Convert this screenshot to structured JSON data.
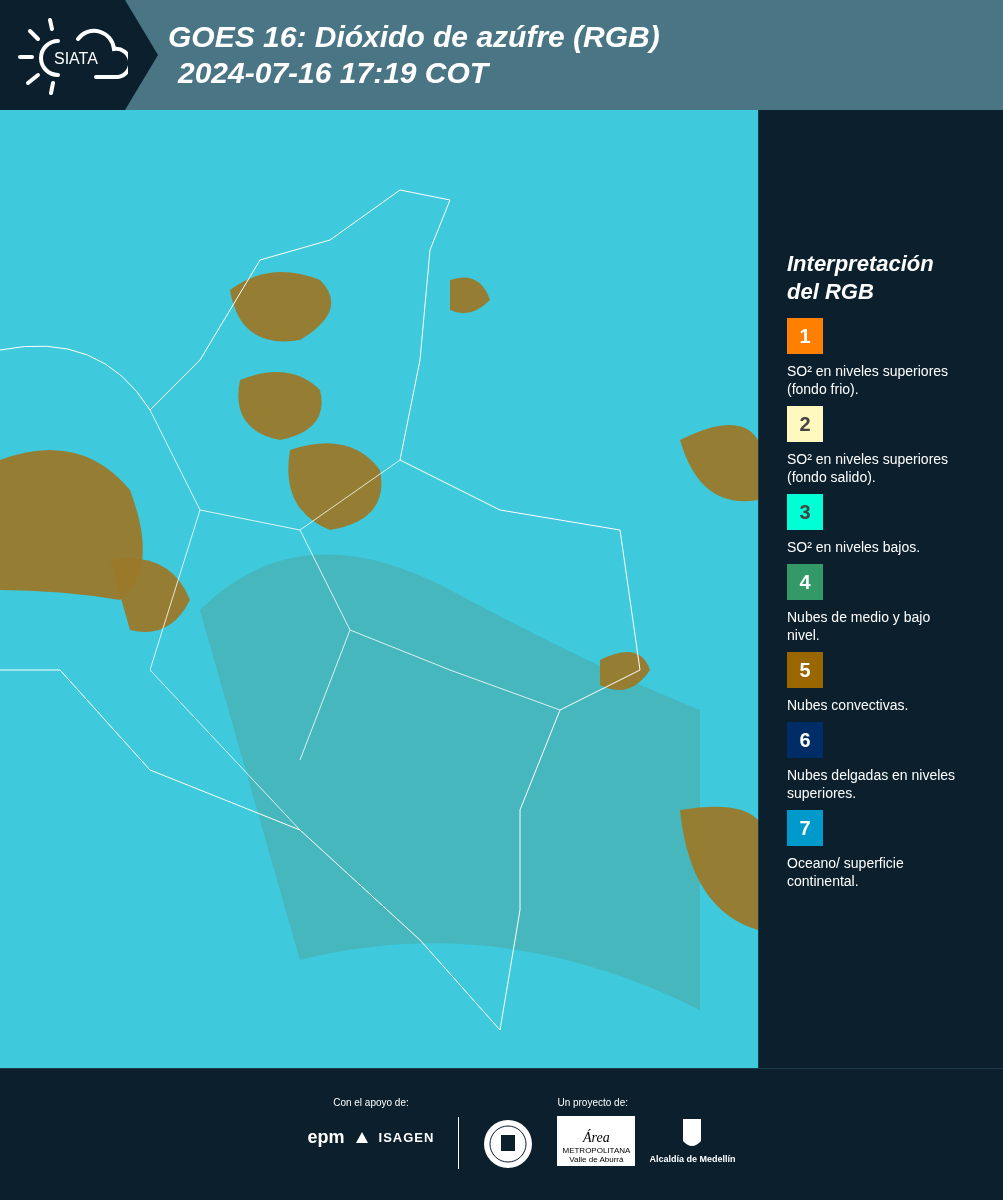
{
  "header": {
    "logo": "SIATA",
    "title": "GOES 16: Dióxido de azúfre (RGB)",
    "timestamp": "2024-07-16 17:19 COT"
  },
  "legend": {
    "title_line1": "Interpretación",
    "title_line2": "del RGB",
    "items": [
      {
        "number": "1",
        "color": "#ff7f00",
        "label": "SO² en niveles superiores (fondo frio)."
      },
      {
        "number": "2",
        "color": "#fff8bf",
        "label": "SO² en niveles superiores (fondo salido)."
      },
      {
        "number": "3",
        "color": "#00ffd4",
        "label": "SO² en niveles bajos."
      },
      {
        "number": "4",
        "color": "#339966",
        "label": "Nubes de medio y bajo nivel."
      },
      {
        "number": "5",
        "color": "#996600",
        "label": "Nubes convectivas."
      },
      {
        "number": "6",
        "color": "#002d66",
        "label": "Nubes delgadas en niveles superiores."
      },
      {
        "number": "7",
        "color": "#0099cc",
        "label": "Oceano/ superficie continental."
      }
    ]
  },
  "footer": {
    "support_label": "Con el apoyo de:",
    "support_logos": [
      "epm",
      "ISAGEN"
    ],
    "project_label": "Un proyecto de:",
    "area_logo": {
      "title": "Área",
      "line1": "METROPOLITANA",
      "line2": "Valle de Aburrá"
    },
    "alcaldia": "Alcaldía de Medellín"
  }
}
